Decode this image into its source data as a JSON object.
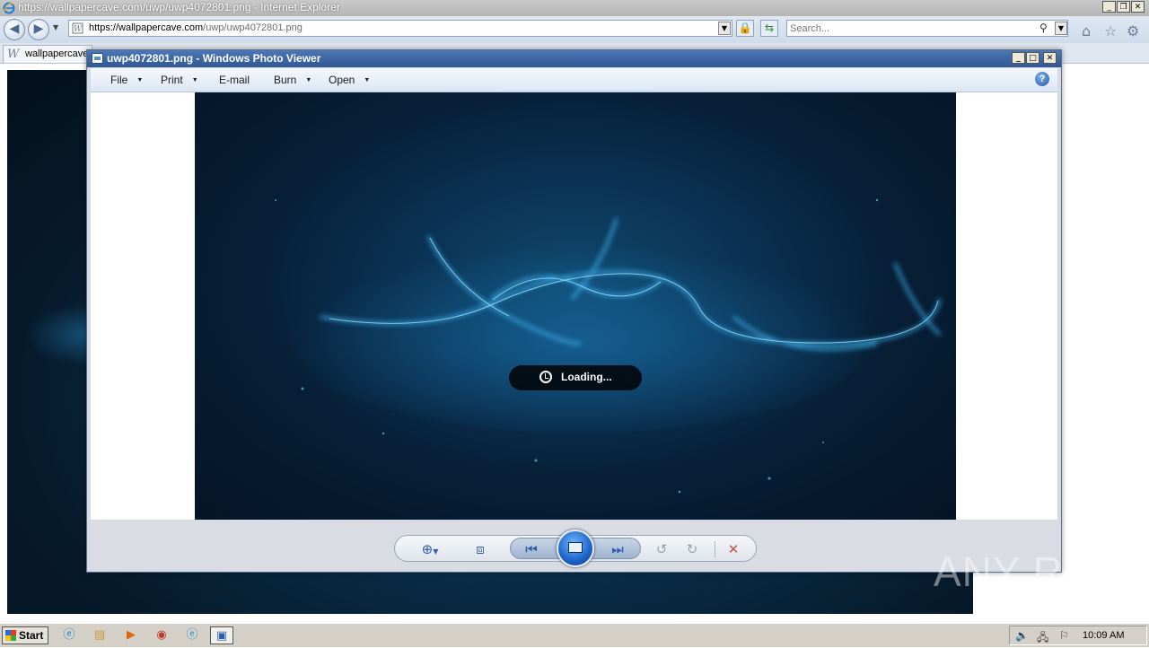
{
  "browser": {
    "title": "https://wallpapercave.com/uwp/uwp4072801.png - Internet Explorer",
    "url_host": "https://wallpapercave.com",
    "url_path": "/uwp/uwp4072801.png",
    "search_placeholder": "Search...",
    "tab_label": "wallpapercave"
  },
  "photo_viewer": {
    "title": "uwp4072801.png - Windows Photo Viewer",
    "menu": [
      {
        "label": "File"
      },
      {
        "label": "Print"
      },
      {
        "label": "E-mail"
      },
      {
        "label": "Burn"
      },
      {
        "label": "Open"
      }
    ],
    "help": "?",
    "loading_text": "Loading...",
    "controls": [
      "zoom-icon",
      "actual-size-icon",
      "previous-icon",
      "slideshow-icon",
      "next-icon",
      "rotate-ccw-icon",
      "rotate-cw-icon",
      "delete-icon"
    ]
  },
  "taskbar": {
    "start_label": "Start",
    "clock": "10:09 AM"
  },
  "watermark": "ANY RUN"
}
